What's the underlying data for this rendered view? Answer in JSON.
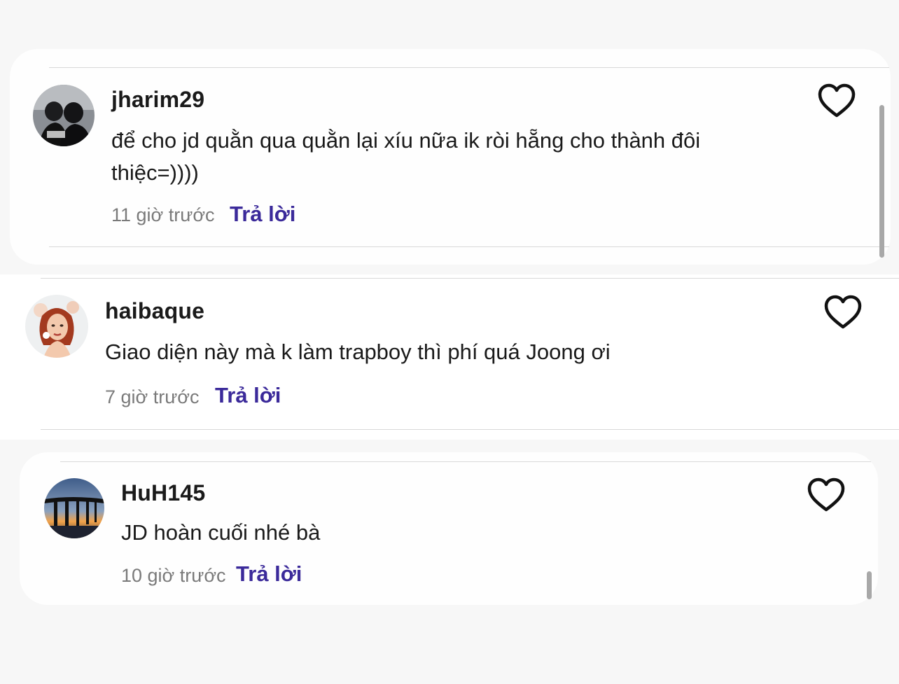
{
  "comments": [
    {
      "username": "jharim29",
      "text": "để cho jd quằn qua quằn lại xíu nữa ik ròi hẵng cho thành đôi thiệc=))))",
      "time": "11 giờ trước",
      "reply_label": "Trả lời",
      "like_icon": "heart-outline-icon"
    },
    {
      "username": "haibaque",
      "text": "Giao diện này mà k làm trapboy thì phí quá Joong ơi",
      "time": "7 giờ trước",
      "reply_label": "Trả lời",
      "like_icon": "heart-outline-icon"
    },
    {
      "username": "HuH145",
      "text": "JD hoàn cuối nhé bà",
      "time": "10 giờ trước",
      "reply_label": "Trả lời",
      "like_icon": "heart-outline-icon"
    }
  ],
  "colors": {
    "accent": "#3b2a9a",
    "timestamp": "#7a7a7a",
    "text": "#1a1a1a"
  }
}
